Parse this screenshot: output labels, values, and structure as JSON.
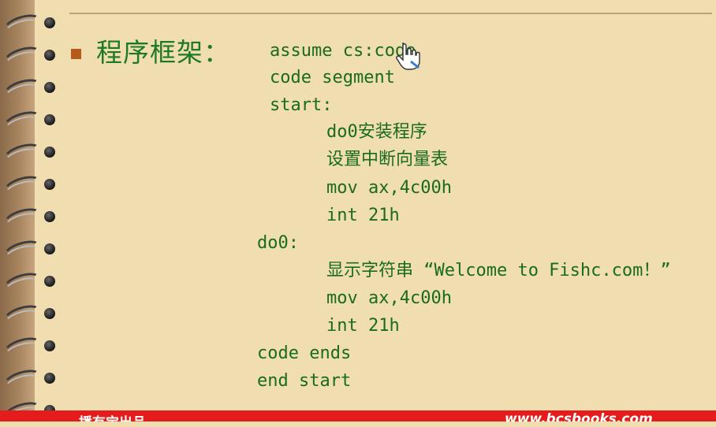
{
  "slide": {
    "heading": "程序框架：",
    "code_lines": [
      "assume cs:code",
      "code segment",
      "start:",
      "do0安装程序",
      "设置中断向量表",
      "mov ax,4c00h",
      "int 21h",
      "do0:",
      "显示字符串 “Welcome to Fishc.com！”",
      "mov ax,4c00h",
      "int 21h",
      "code ends",
      "end start"
    ]
  },
  "footer": {
    "left_text": "播有宝出品",
    "right_text": "www.bcsbooks.com"
  },
  "colors": {
    "background": "#f0ddb0",
    "code_text": "#1a6b1f",
    "heading": "#1d7a24",
    "bullet": "#b55a1a",
    "footer_bar": "#e51c1c"
  }
}
